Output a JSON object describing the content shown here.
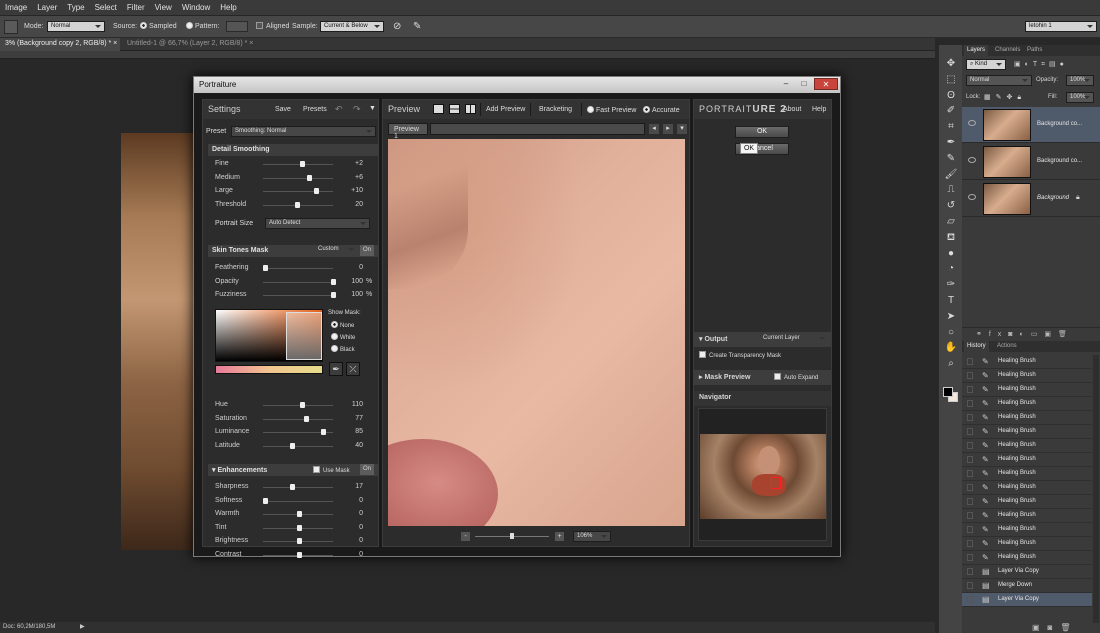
{
  "menu": [
    "Image",
    "Layer",
    "Type",
    "Select",
    "Filter",
    "View",
    "Window",
    "Help"
  ],
  "options_bar": {
    "mode_label": "Mode:",
    "mode_value": "Normal",
    "source_label": "Source:",
    "sampled_label": "Sampled",
    "pattern_label": "Pattern:",
    "aligned_label": "Aligned",
    "sample_label": "Sample:",
    "sample_value": "Current & Below",
    "workspace_value": "letohin 1"
  },
  "doc_tabs": [
    "3% (Background copy 2, RGB/8) *",
    "Untitled-1 @ 66,7% (Layer 2, RGB/8) *"
  ],
  "status": "Doc: 60,2M/180,5M",
  "dialog": {
    "title": "Portraiture",
    "settings": {
      "header": "Settings",
      "save": "Save",
      "presets": "Presets",
      "preset_label": "Preset",
      "preset_value": "Smoothing: Normal",
      "detail_smoothing": "Detail Smoothing",
      "detail_rows": [
        {
          "label": "Fine",
          "value": "+2",
          "pos": 0.55
        },
        {
          "label": "Medium",
          "value": "+6",
          "pos": 0.65
        },
        {
          "label": "Large",
          "value": "+10",
          "pos": 0.75
        },
        {
          "label": "Threshold",
          "value": "20",
          "pos": 0.47
        }
      ],
      "portrait_size_label": "Portrait Size",
      "portrait_size_value": "Auto Detect",
      "skin_tones_mask": "Skin Tones Mask",
      "skin_mode": "Custom",
      "on_label": "On",
      "skin_rows": [
        {
          "label": "Feathering",
          "value": "0",
          "unit": "",
          "pos": 0.0
        },
        {
          "label": "Opacity",
          "value": "100",
          "unit": "%",
          "pos": 1.0
        },
        {
          "label": "Fuzziness",
          "value": "100",
          "unit": "%",
          "pos": 1.0
        }
      ],
      "show_mask_label": "Show Mask:",
      "show_mask_options": [
        "None",
        "White",
        "Black"
      ],
      "hsl_rows": [
        {
          "label": "Hue",
          "value": "110",
          "pos": 0.55
        },
        {
          "label": "Saturation",
          "value": "77",
          "pos": 0.6
        },
        {
          "label": "Luminance",
          "value": "85",
          "pos": 0.85
        },
        {
          "label": "Latitude",
          "value": "40",
          "pos": 0.4
        }
      ],
      "enhancements": "Enhancements",
      "use_mask": "Use Mask",
      "enh_rows": [
        {
          "label": "Sharpness",
          "value": "17",
          "pos": 0.4
        },
        {
          "label": "Softness",
          "value": "0",
          "pos": 0.0
        },
        {
          "label": "Warmth",
          "value": "0",
          "pos": 0.5
        },
        {
          "label": "Tint",
          "value": "0",
          "pos": 0.5
        },
        {
          "label": "Brightness",
          "value": "0",
          "pos": 0.5
        },
        {
          "label": "Contrast",
          "value": "0",
          "pos": 0.5
        }
      ]
    },
    "preview": {
      "header": "Preview",
      "add_preview": "Add Preview",
      "bracketing": "Bracketing",
      "fast_preview": "Fast Preview",
      "accurate": "Accurate",
      "tab": "Preview 1",
      "zoom": "106%"
    },
    "right": {
      "brand_a": "Portrait",
      "brand_b": "ure 2",
      "about": "About",
      "help": "Help",
      "ok": "OK",
      "cancel": "Cancel",
      "output_label": "Output",
      "output_value": "Current Layer",
      "create_transparency": "Create Transparency Mask",
      "mask_preview": "Mask Preview",
      "auto_expand": "Auto Expand",
      "navigator": "Navigator"
    }
  },
  "panels": {
    "tabs_top": [
      "Layers",
      "Channels",
      "Paths"
    ],
    "kind": "Kind",
    "blend_mode": "Normal",
    "opacity_label": "Opacity:",
    "opacity_value": "100%",
    "lock_label": "Lock:",
    "fill_label": "Fill:",
    "fill_value": "100%",
    "layers": [
      "Background co...",
      "Background co...",
      "Background"
    ],
    "history_tabs": [
      "History",
      "Actions"
    ],
    "history": [
      "Healing Brush",
      "Healing Brush",
      "Healing Brush",
      "Healing Brush",
      "Healing Brush",
      "Healing Brush",
      "Healing Brush",
      "Healing Brush",
      "Healing Brush",
      "Healing Brush",
      "Healing Brush",
      "Healing Brush",
      "Healing Brush",
      "Healing Brush",
      "Healing Brush",
      "Layer Via Copy",
      "Merge Down",
      "Layer Via Copy"
    ]
  }
}
